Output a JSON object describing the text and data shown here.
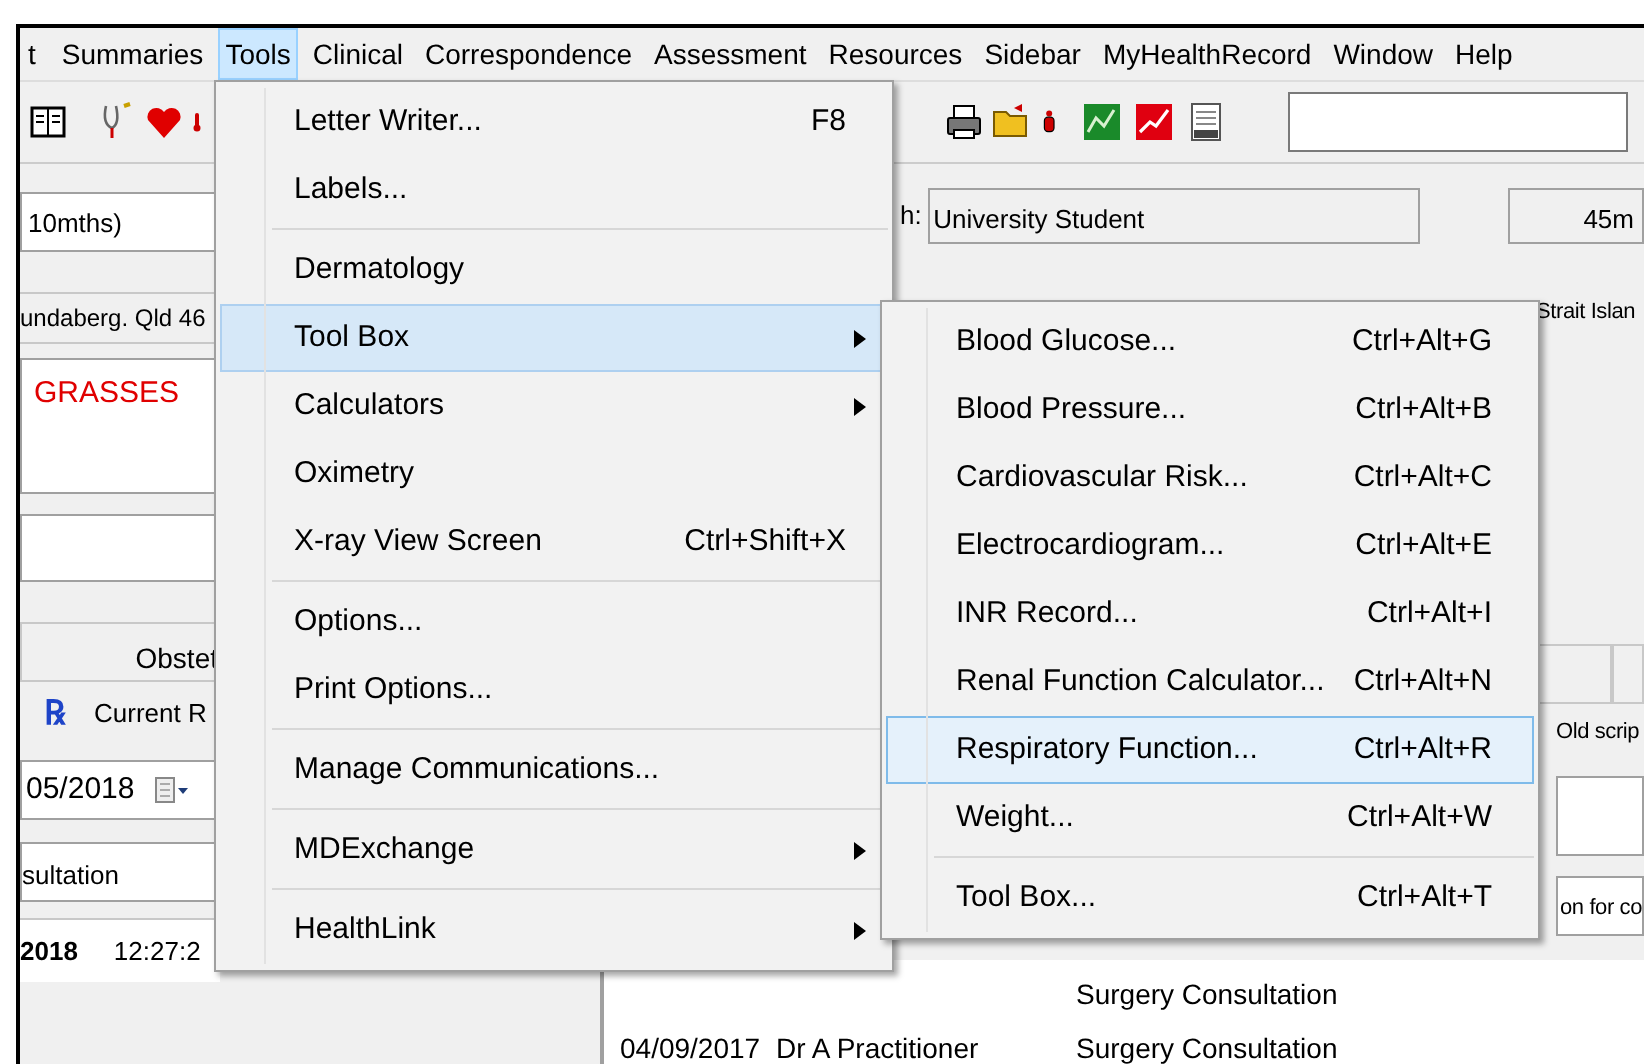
{
  "menubar": [
    {
      "label": "t",
      "selected": false
    },
    {
      "label": "Summaries",
      "selected": false
    },
    {
      "label": "Tools",
      "selected": true
    },
    {
      "label": "Clinical",
      "selected": false
    },
    {
      "label": "Correspondence",
      "selected": false
    },
    {
      "label": "Assessment",
      "selected": false
    },
    {
      "label": "Resources",
      "selected": false
    },
    {
      "label": "Sidebar",
      "selected": false
    },
    {
      "label": "MyHealthRecord",
      "selected": false
    },
    {
      "label": "Window",
      "selected": false
    },
    {
      "label": "Help",
      "selected": false
    }
  ],
  "patient_panel": {
    "age": "10mths)",
    "address": "undaberg. Qld 46",
    "allergy": "GRASSES",
    "tab": "Obstet",
    "rx_icon": "℞",
    "rx_label": "Current R",
    "date": "05/2018",
    "reason": "sultation",
    "visit_date": "2018",
    "visit_time": "12:27:2"
  },
  "occupation": {
    "label": "h:",
    "value": "University Student",
    "field_2": "45m"
  },
  "right_strip": {
    "text_1": "Strait Islan",
    "text_2": "Old scrip",
    "text_3": "on for co"
  },
  "history": [
    {
      "type": "Surgery Consultation"
    },
    {
      "date": "04/09/2017",
      "doctor": "Dr A Practitioner",
      "type": "Surgery Consultation"
    }
  ],
  "tools_menu": [
    {
      "kind": "item",
      "label": "Letter Writer...",
      "shortcut": "F8",
      "highlighted": false,
      "submenu": false
    },
    {
      "kind": "item",
      "label": "Labels...",
      "highlighted": false,
      "submenu": false
    },
    {
      "kind": "separator"
    },
    {
      "kind": "item",
      "label": "Dermatology",
      "highlighted": false,
      "submenu": false
    },
    {
      "kind": "item",
      "label": "Tool Box",
      "highlighted": true,
      "submenu": true
    },
    {
      "kind": "item",
      "label": "Calculators",
      "highlighted": false,
      "submenu": true
    },
    {
      "kind": "item",
      "label": "Oximetry",
      "highlighted": false,
      "submenu": false
    },
    {
      "kind": "item",
      "label": "X-ray View Screen",
      "shortcut": "Ctrl+Shift+X",
      "highlighted": false,
      "submenu": false
    },
    {
      "kind": "separator"
    },
    {
      "kind": "item",
      "label": "Options...",
      "highlighted": false,
      "submenu": false
    },
    {
      "kind": "item",
      "label": "Print Options...",
      "highlighted": false,
      "submenu": false
    },
    {
      "kind": "separator"
    },
    {
      "kind": "item",
      "label": "Manage Communications...",
      "highlighted": false,
      "submenu": false
    },
    {
      "kind": "separator"
    },
    {
      "kind": "item",
      "label": "MDExchange",
      "highlighted": false,
      "submenu": true
    },
    {
      "kind": "separator"
    },
    {
      "kind": "item",
      "label": "HealthLink",
      "highlighted": false,
      "submenu": true
    }
  ],
  "toolbox_submenu": [
    {
      "kind": "item",
      "label": "Blood Glucose...",
      "shortcut": "Ctrl+Alt+G",
      "highlighted": false
    },
    {
      "kind": "item",
      "label": "Blood Pressure...",
      "shortcut": "Ctrl+Alt+B",
      "highlighted": false
    },
    {
      "kind": "item",
      "label": "Cardiovascular Risk...",
      "shortcut": "Ctrl+Alt+C",
      "highlighted": false
    },
    {
      "kind": "item",
      "label": "Electrocardiogram...",
      "shortcut": "Ctrl+Alt+E",
      "highlighted": false
    },
    {
      "kind": "item",
      "label": "INR Record...",
      "shortcut": "Ctrl+Alt+I",
      "highlighted": false
    },
    {
      "kind": "item",
      "label": "Renal Function Calculator...",
      "shortcut": "Ctrl+Alt+N",
      "highlighted": false
    },
    {
      "kind": "item",
      "label": "Respiratory Function...",
      "shortcut": "Ctrl+Alt+R",
      "highlighted": true
    },
    {
      "kind": "item",
      "label": "Weight...",
      "shortcut": "Ctrl+Alt+W",
      "highlighted": false
    },
    {
      "kind": "separator"
    },
    {
      "kind": "item",
      "label": "Tool Box...",
      "shortcut": "Ctrl+Alt+T",
      "highlighted": false
    }
  ]
}
